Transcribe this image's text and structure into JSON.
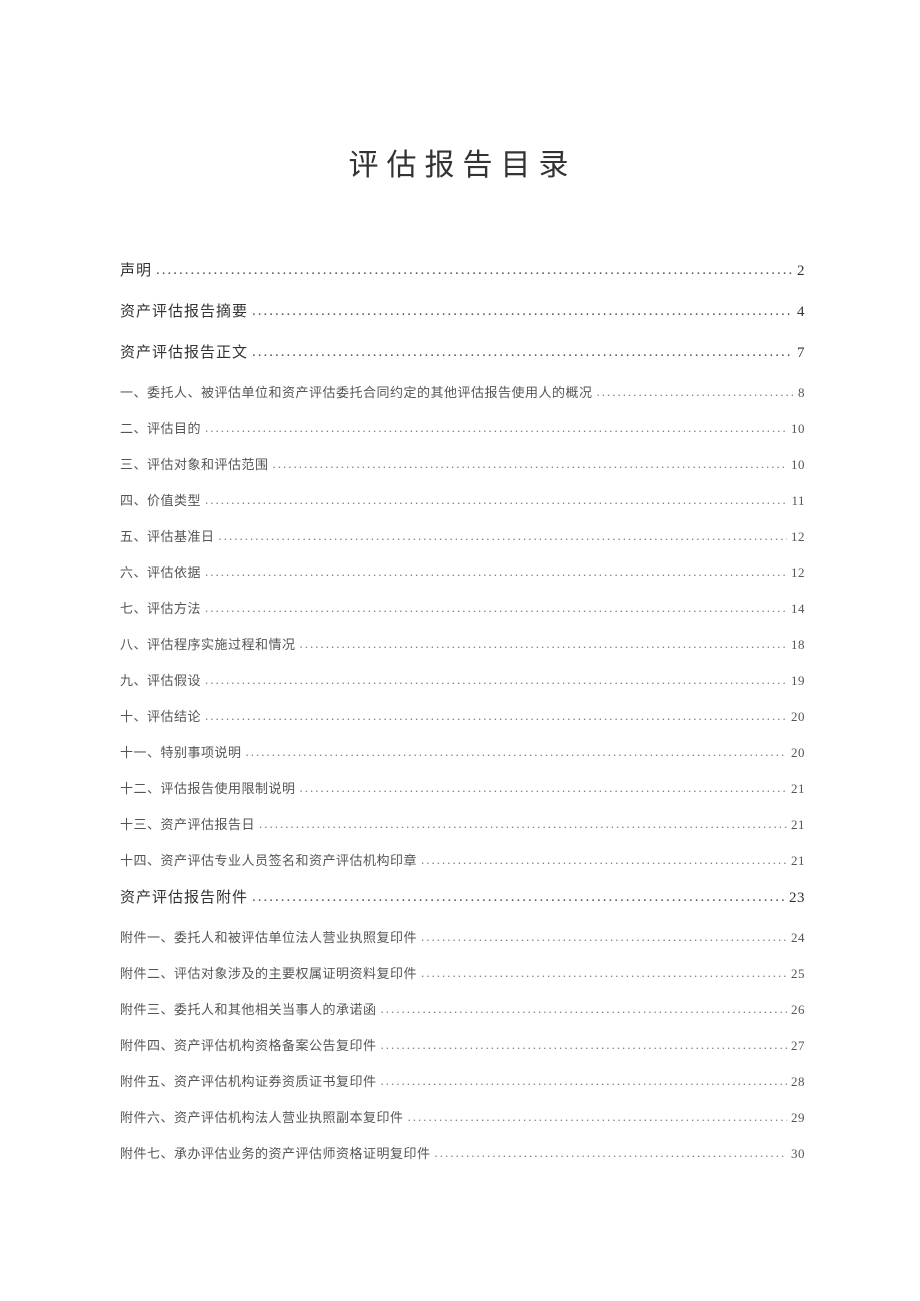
{
  "title": "评估报告目录",
  "toc": [
    {
      "label": "声明",
      "page": "2",
      "level": 1
    },
    {
      "label": "资产评估报告摘要",
      "page": "4",
      "level": 1
    },
    {
      "label": "资产评估报告正文",
      "page": "7",
      "level": 1
    },
    {
      "label": "一、委托人、被评估单位和资产评估委托合同约定的其他评估报告使用人的概况",
      "page": "8",
      "level": 2
    },
    {
      "label": "二、评估目的",
      "page": "10",
      "level": 2
    },
    {
      "label": "三、评估对象和评估范围",
      "page": "10",
      "level": 2
    },
    {
      "label": "四、价值类型",
      "page": "11",
      "level": 2
    },
    {
      "label": "五、评估基准日",
      "page": "12",
      "level": 2
    },
    {
      "label": "六、评估依据",
      "page": "12",
      "level": 2
    },
    {
      "label": "七、评估方法",
      "page": "14",
      "level": 2
    },
    {
      "label": "八、评估程序实施过程和情况",
      "page": "18",
      "level": 2
    },
    {
      "label": "九、评估假设",
      "page": "19",
      "level": 2
    },
    {
      "label": "十、评估结论",
      "page": "20",
      "level": 2
    },
    {
      "label": "十一、特别事项说明",
      "page": "20",
      "level": 2
    },
    {
      "label": "十二、评估报告使用限制说明",
      "page": "21",
      "level": 2
    },
    {
      "label": "十三、资产评估报告日",
      "page": "21",
      "level": 2
    },
    {
      "label": "十四、资产评估专业人员签名和资产评估机构印章",
      "page": "21",
      "level": 2
    },
    {
      "label": "资产评估报告附件",
      "page": "23",
      "level": 1
    },
    {
      "label": "附件一、委托人和被评估单位法人营业执照复印件",
      "page": "24",
      "level": 2
    },
    {
      "label": "附件二、评估对象涉及的主要权属证明资料复印件",
      "page": "25",
      "level": 2
    },
    {
      "label": "附件三、委托人和其他相关当事人的承诺函",
      "page": "26",
      "level": 2
    },
    {
      "label": "附件四、资产评估机构资格备案公告复印件",
      "page": "27",
      "level": 2
    },
    {
      "label": "附件五、资产评估机构证券资质证书复印件",
      "page": "28",
      "level": 2
    },
    {
      "label": "附件六、资产评估机构法人营业执照副本复印件",
      "page": "29",
      "level": 2
    },
    {
      "label": "附件七、承办评估业务的资产评估师资格证明复印件",
      "page": "30",
      "level": 2
    }
  ]
}
